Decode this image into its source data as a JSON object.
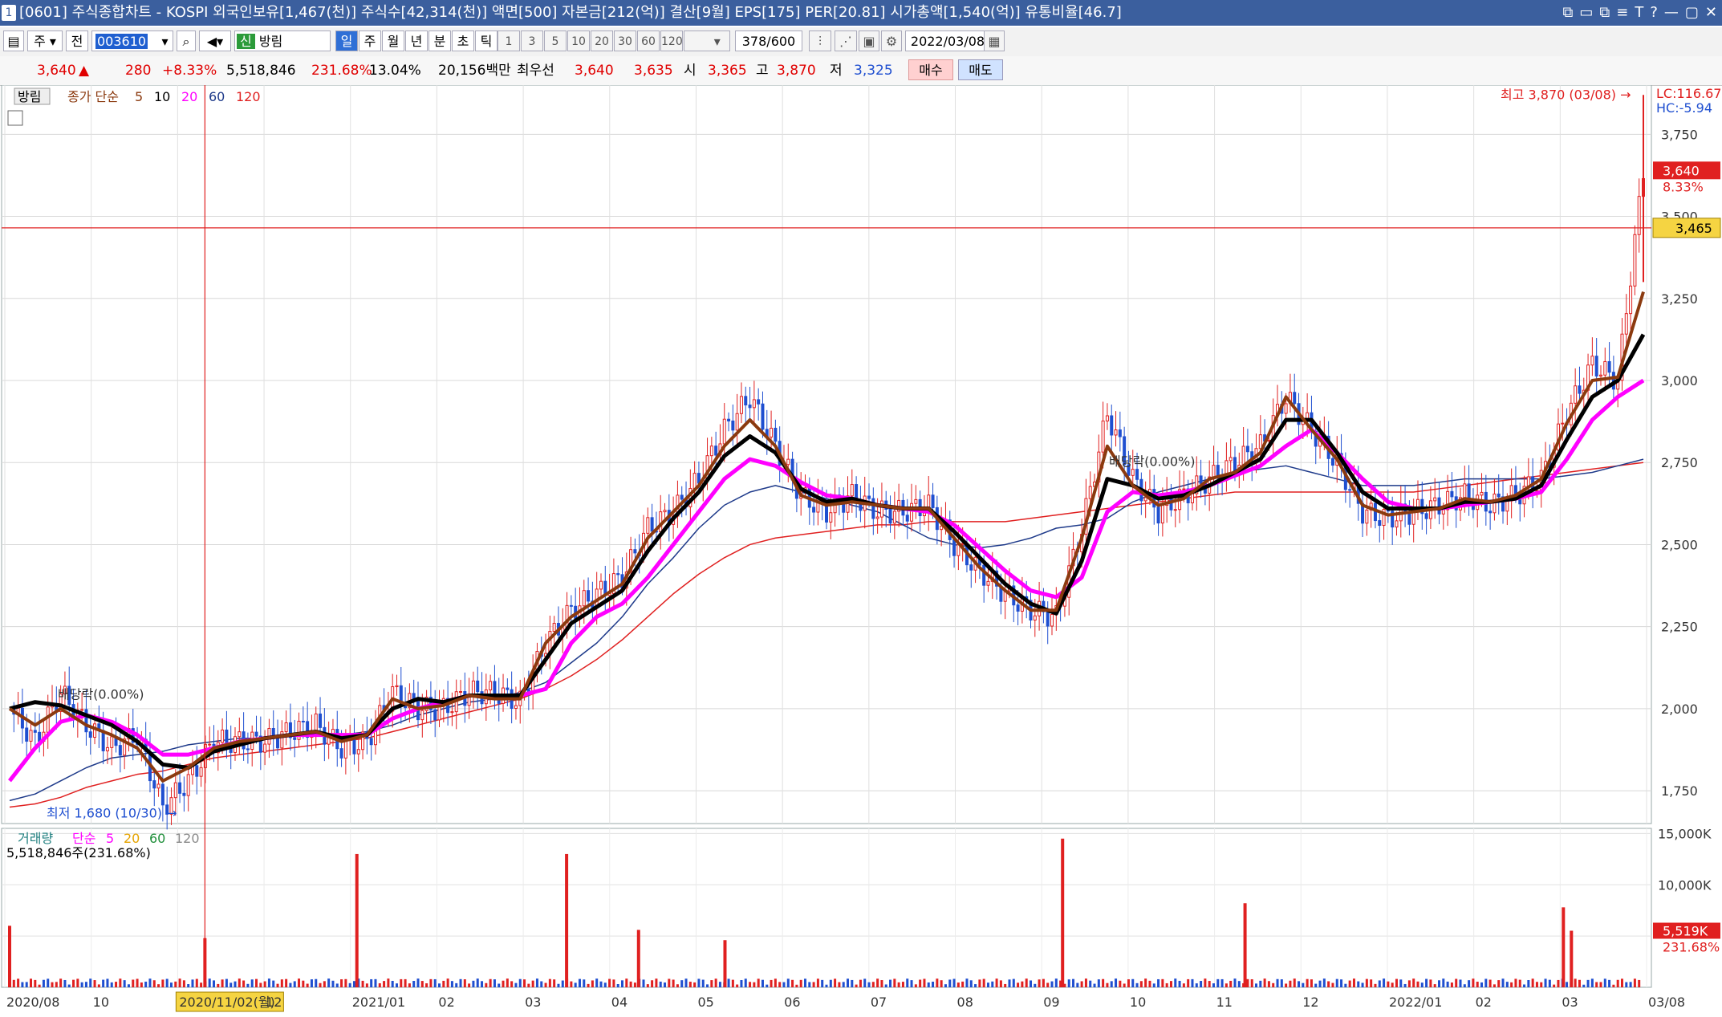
{
  "window": {
    "index": "1",
    "title": "[0601] 주식종합차트 - KOSPI 외국인보유[1,467(천)] 주식수[42,314(천)] 액면[500] 자본금[212(억)] 결산[9월] EPS[175] PER[20.81] 시가총액[1,540(억)] 유통비율[46.7]",
    "controls": [
      "⧉",
      "▭",
      "⧉",
      "≡",
      "T",
      "?",
      "—",
      "▢",
      "✕"
    ]
  },
  "toolbar": {
    "market": "주",
    "all": "전",
    "code": "003610",
    "stock_badge": "신",
    "stock_name": "방림",
    "periods": [
      "일",
      "주",
      "월",
      "년",
      "분",
      "초",
      "틱"
    ],
    "active_period": "일",
    "intervals": [
      "1",
      "3",
      "5",
      "10",
      "20",
      "30",
      "60",
      "120"
    ],
    "count": "378",
    "count_max": "/600",
    "date": "2022/03/08"
  },
  "info": {
    "price": "3,640",
    "arrow": "▲",
    "change": "280",
    "change_pct": "+8.33%",
    "volume": "5,518,846",
    "volume_pct": "231.68%",
    "turnover": "13.04%",
    "amount": "20,156백만",
    "bid_label": "최우선",
    "ask": "3,640",
    "bid": "3,635",
    "open_label": "시",
    "open": "3,365",
    "high_label": "고",
    "high": "3,870",
    "low_label": "저",
    "low": "3,325",
    "buy_label": "매수",
    "sell_label": "매도"
  },
  "price_legend": {
    "name": "방림",
    "ma_label": "종가 단순",
    "periods": [
      "5",
      "10",
      "20",
      "60",
      "120"
    ],
    "colors": [
      "#8b3a0f",
      "#000000",
      "#ff00ff",
      "#1e3a8a",
      "#e02020"
    ]
  },
  "price_axis": {
    "lc": "LC:116.67",
    "hc": "HC:-5.94",
    "ticks": [
      "3,750",
      "3,500",
      "3,250",
      "3,000",
      "2,750",
      "2,500",
      "2,250",
      "2,000",
      "1,750"
    ],
    "tick_values": [
      3750,
      3500,
      3250,
      3000,
      2750,
      2500,
      2250,
      2000,
      1750
    ],
    "current": "3,640",
    "current_pct": "8.33%",
    "crosshair": "3,465"
  },
  "annotations": {
    "high": "최고 3,870 (03/08)",
    "low": "최저 1,680 (10/30)",
    "ex1": "배당락(0.00%)",
    "ex2": "배당락(0.00%)"
  },
  "volume_legend": {
    "name": "거래량",
    "ma_label": "단순",
    "periods": [
      "5",
      "20",
      "60",
      "120"
    ],
    "colors": [
      "#ff00ff",
      "#e6a400",
      "#1f8f3a",
      "#8a8a8a"
    ],
    "value": "5,518,846주(231.68%)"
  },
  "volume_axis": {
    "ticks": [
      "15,000K",
      "10,000K"
    ],
    "current": "5,519K",
    "current_pct": "231.68%"
  },
  "x_axis": {
    "labels": [
      "2020/08",
      "10",
      "2020/11/02(월)",
      "12",
      "2021/01",
      "02",
      "03",
      "04",
      "05",
      "06",
      "07",
      "08",
      "09",
      "10",
      "11",
      "12",
      "2022/01",
      "02",
      "03",
      "03/08"
    ]
  },
  "chart_data": {
    "type": "candlestick",
    "x_range": [
      "2020/08",
      "2022/03/08"
    ],
    "y_range": [
      1650,
      3900
    ],
    "high": {
      "value": 3870,
      "date": "03/08"
    },
    "low": {
      "value": 1680,
      "date": "10/30"
    },
    "close_path": [
      2000,
      1900,
      2050,
      1950,
      1880,
      1920,
      1700,
      1780,
      1900,
      1900,
      1900,
      1930,
      1950,
      1880,
      1900,
      2050,
      2000,
      2000,
      2050,
      2050,
      2020,
      2200,
      2300,
      2350,
      2400,
      2550,
      2600,
      2700,
      2850,
      2950,
      2800,
      2650,
      2600,
      2650,
      2600,
      2600,
      2620,
      2500,
      2420,
      2350,
      2300,
      2280,
      2550,
      2900,
      2700,
      2600,
      2650,
      2700,
      2750,
      2800,
      2950,
      2850,
      2750,
      2600,
      2580,
      2600,
      2620,
      2650,
      2620,
      2650,
      2700,
      2900,
      3050,
      3000,
      3640
    ],
    "ma_paths": {
      "ma5": [
        2000,
        1950,
        2000,
        1950,
        1920,
        1880,
        1780,
        1820,
        1880,
        1900,
        1910,
        1920,
        1930,
        1900,
        1920,
        2030,
        2000,
        2010,
        2040,
        2030,
        2030,
        2200,
        2280,
        2330,
        2380,
        2520,
        2600,
        2680,
        2800,
        2880,
        2800,
        2650,
        2620,
        2630,
        2620,
        2610,
        2610,
        2520,
        2430,
        2360,
        2300,
        2300,
        2520,
        2800,
        2680,
        2620,
        2640,
        2700,
        2720,
        2780,
        2950,
        2850,
        2760,
        2620,
        2590,
        2600,
        2610,
        2640,
        2630,
        2650,
        2700,
        2870,
        3000,
        3010,
        3270
      ],
      "ma10": [
        2000,
        2020,
        2010,
        1980,
        1950,
        1900,
        1830,
        1820,
        1870,
        1890,
        1910,
        1920,
        1930,
        1910,
        1920,
        2000,
        2030,
        2020,
        2040,
        2040,
        2040,
        2150,
        2260,
        2310,
        2360,
        2480,
        2580,
        2660,
        2770,
        2830,
        2780,
        2670,
        2630,
        2640,
        2620,
        2610,
        2610,
        2540,
        2460,
        2380,
        2320,
        2290,
        2450,
        2700,
        2680,
        2640,
        2650,
        2680,
        2720,
        2760,
        2880,
        2880,
        2780,
        2660,
        2610,
        2610,
        2610,
        2630,
        2630,
        2640,
        2680,
        2820,
        2950,
        3000,
        3140
      ],
      "ma20": [
        1780,
        1880,
        1960,
        1980,
        1960,
        1920,
        1860,
        1860,
        1880,
        1900,
        1910,
        1920,
        1920,
        1920,
        1920,
        1970,
        2000,
        2020,
        2040,
        2040,
        2040,
        2060,
        2200,
        2280,
        2320,
        2400,
        2500,
        2600,
        2700,
        2760,
        2740,
        2690,
        2650,
        2640,
        2620,
        2610,
        2600,
        2560,
        2490,
        2420,
        2360,
        2340,
        2400,
        2600,
        2660,
        2650,
        2660,
        2680,
        2710,
        2740,
        2800,
        2850,
        2780,
        2700,
        2630,
        2610,
        2610,
        2620,
        2630,
        2640,
        2660,
        2760,
        2880,
        2950,
        3000
      ],
      "ma60": [
        1720,
        1740,
        1780,
        1820,
        1850,
        1860,
        1870,
        1890,
        1900,
        1910,
        1910,
        1920,
        1920,
        1920,
        1930,
        1950,
        1980,
        2000,
        2020,
        2030,
        2050,
        2080,
        2140,
        2200,
        2280,
        2380,
        2460,
        2550,
        2620,
        2660,
        2680,
        2660,
        2640,
        2620,
        2600,
        2560,
        2520,
        2500,
        2490,
        2500,
        2520,
        2550,
        2560,
        2580,
        2630,
        2660,
        2680,
        2700,
        2720,
        2730,
        2740,
        2720,
        2700,
        2680,
        2680,
        2680,
        2690,
        2700,
        2700,
        2700,
        2700,
        2710,
        2720,
        2740,
        2760
      ],
      "ma120": [
        1700,
        1710,
        1730,
        1760,
        1780,
        1800,
        1810,
        1830,
        1850,
        1860,
        1870,
        1880,
        1890,
        1900,
        1910,
        1930,
        1950,
        1970,
        1990,
        2010,
        2030,
        2060,
        2100,
        2150,
        2210,
        2280,
        2350,
        2410,
        2460,
        2500,
        2520,
        2530,
        2540,
        2550,
        2560,
        2560,
        2570,
        2570,
        2570,
        2570,
        2580,
        2590,
        2600,
        2610,
        2620,
        2630,
        2640,
        2650,
        2660,
        2660,
        2660,
        2660,
        2660,
        2660,
        2660,
        2660,
        2670,
        2680,
        2690,
        2700,
        2710,
        2720,
        2730,
        2740,
        2750
      ]
    },
    "volume_spikes_k": [
      {
        "x": "2020/08",
        "v": 6000
      },
      {
        "x": "2020/11/02",
        "v": 4800
      },
      {
        "x": "2021/01",
        "v": 13000
      },
      {
        "x": "2021/03",
        "v": 13000
      },
      {
        "x": "2021/04",
        "v": 5600
      },
      {
        "x": "2021/05",
        "v": 4600
      },
      {
        "x": "2021/09",
        "v": 14500
      },
      {
        "x": "2021/11",
        "v": 8200
      },
      {
        "x": "2022/03/07",
        "v": 7800
      },
      {
        "x": "2022/03/08",
        "v": 5519
      }
    ],
    "volume_ylim_k": [
      0,
      15500
    ]
  }
}
